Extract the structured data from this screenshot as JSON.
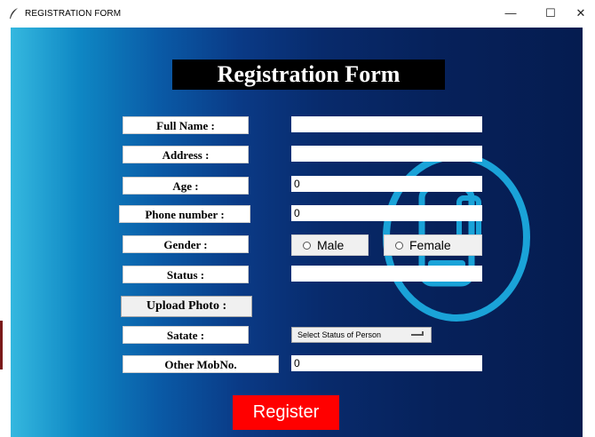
{
  "window": {
    "title": "REGISTRATION FORM",
    "minimize": "—",
    "maximize": "☐",
    "close": "✕"
  },
  "form": {
    "heading": "Registration Form",
    "labels": {
      "full_name": "Full Name :",
      "address": "Address :",
      "age": "Age :",
      "phone": "Phone number :",
      "gender": "Gender :",
      "status": "Status :",
      "state": "Satate :",
      "other_mob": "Other MobNo."
    },
    "values": {
      "full_name": "",
      "address": "",
      "age": "0",
      "phone": "0",
      "status": "",
      "other_mob": "0"
    },
    "gender_options": {
      "male": "Male",
      "female": "Female"
    },
    "upload_button": "Upload Photo :",
    "state_select": "Select Status of Person",
    "register_button": "Register"
  },
  "colors": {
    "background_left": "#35b8df",
    "background_right": "#051c50",
    "register": "#ff0000",
    "decoration": "#1aa3d8"
  },
  "icons": {
    "app": "feather-icon",
    "decoration": "phone-in-circle-icon"
  }
}
